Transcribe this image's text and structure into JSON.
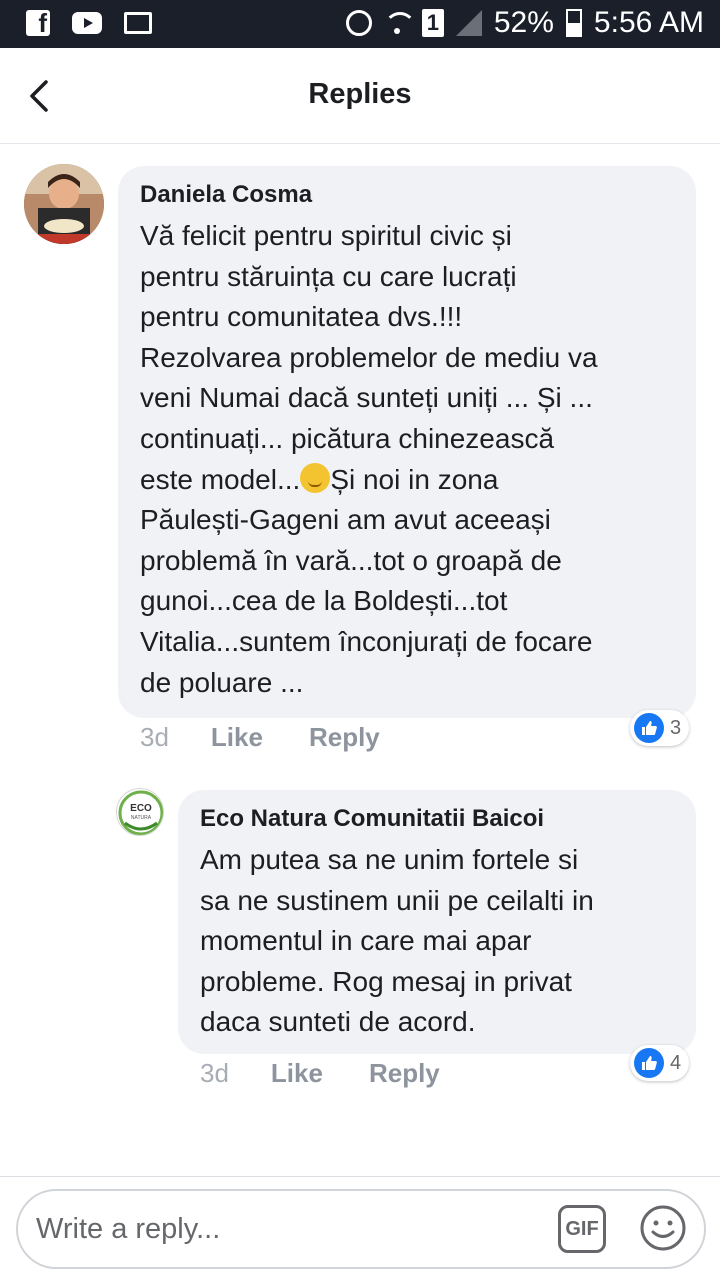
{
  "status_bar": {
    "battery_percent": "52%",
    "time": "5:56 AM",
    "sim_slot": "1",
    "left_icons": [
      "facebook-icon",
      "youtube-icon",
      "mail-icon"
    ],
    "right_icons": [
      "alarm-icon",
      "wifi-icon",
      "sim-icon",
      "signal-icon",
      "battery-icon"
    ]
  },
  "header": {
    "title": "Replies",
    "back_icon": "back-arrow-icon"
  },
  "comments": [
    {
      "author": "Daniela Cosma",
      "text_before_emoji": "Vă felicit pentru spiritul civic și\npentru stăruința cu care lucrați\npentru comunitatea dvs.!!!\nRezolvarea problemelor de mediu va\nveni Numai dacă sunteți uniți ... Și ...\ncontinuați... picătura chinezească\neste model...",
      "emoji": "smirking-face-emoji",
      "text_after_emoji": "Și noi in zona\nPăulești-Gageni am avut aceeași\nproblemă în vară...tot o groapă de\ngunoi...cea de la Boldești...tot\nVitalia...suntem înconjurați de focare\nde poluare ...",
      "time": "3d",
      "like_label": "Like",
      "reply_label": "Reply",
      "reaction_count": "3"
    },
    {
      "author": "Eco Natura Comunitatii Baicoi",
      "avatar_logo_text": "ECO NATURA",
      "text": "Am putea sa ne unim fortele si\nsa ne sustinem unii pe ceilalti in\nmomentul in care mai apar\nprobleme. Rog mesaj in privat\ndaca sunteti de acord.",
      "time": "3d",
      "like_label": "Like",
      "reply_label": "Reply",
      "reaction_count": "4"
    }
  ],
  "composer": {
    "placeholder": "Write a reply...",
    "gif_label": "GIF",
    "emoji_icon": "smiley-icon"
  },
  "colors": {
    "status_bar_bg": "#1b1f2a",
    "bubble_bg": "#f0f2f5",
    "like_blue": "#1877f2",
    "meta_gray": "#8d949e"
  }
}
